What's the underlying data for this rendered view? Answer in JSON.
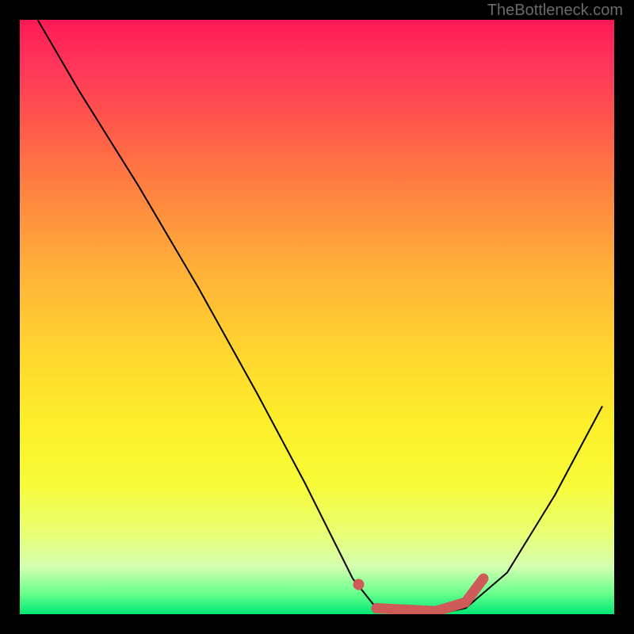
{
  "watermark": "TheBottleneck.com",
  "chart_data": {
    "type": "line",
    "title": "",
    "xlabel": "",
    "ylabel": "",
    "xlim": [
      0,
      100
    ],
    "ylim": [
      0,
      100
    ],
    "series": [
      {
        "name": "bottleneck-curve",
        "x": [
          3,
          10,
          20,
          30,
          40,
          48,
          53,
          56,
          60,
          65,
          70,
          75,
          82,
          90,
          98
        ],
        "y": [
          100,
          88,
          72,
          55,
          37,
          22,
          12,
          6,
          1,
          0,
          0,
          1,
          7,
          20,
          35
        ]
      }
    ],
    "annotations": [
      {
        "name": "highlight-dot",
        "x": 57,
        "y": 5
      },
      {
        "name": "highlight-segment",
        "x": [
          60,
          70,
          75,
          78
        ],
        "y": [
          1,
          0.5,
          2,
          6
        ]
      }
    ]
  }
}
